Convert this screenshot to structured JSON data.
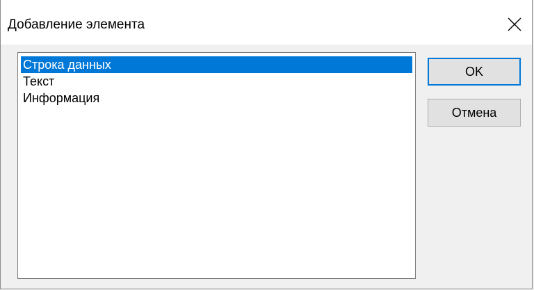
{
  "dialog": {
    "title": "Добавление элемента",
    "close_icon": "close-icon"
  },
  "list": {
    "items": [
      {
        "label": "Строка данных",
        "selected": true
      },
      {
        "label": "Текст",
        "selected": false
      },
      {
        "label": "Информация",
        "selected": false
      }
    ]
  },
  "buttons": {
    "ok_label": "OK",
    "cancel_label": "Отмена"
  },
  "colors": {
    "selection": "#0078d7",
    "button_face": "#e1e1e1"
  }
}
